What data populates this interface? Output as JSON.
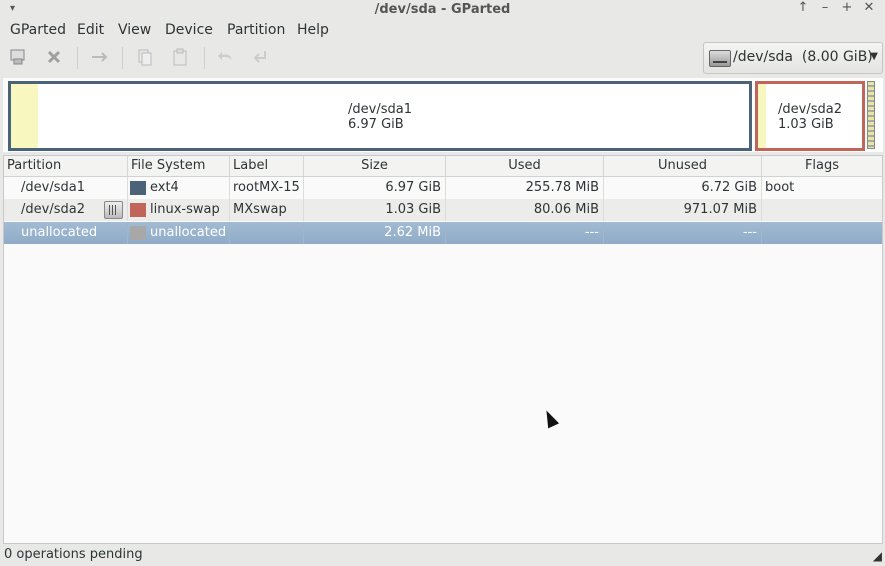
{
  "window": {
    "title": "/dev/sda - GParted",
    "menu_arrow": "▾",
    "controls": [
      "↑",
      "–",
      "+",
      "✕"
    ]
  },
  "menubar": [
    "GParted",
    "Edit",
    "View",
    "Device",
    "Partition",
    "Help"
  ],
  "toolbar": {
    "icons": [
      "new-partition-icon",
      "delete-icon",
      "resize-move-icon",
      "copy-icon",
      "paste-icon",
      "undo-icon",
      "apply-icon"
    ]
  },
  "device_selector": {
    "label": "/dev/sda  (8.00 GiB)"
  },
  "disk_map": {
    "sda1": {
      "name": "/dev/sda1",
      "size": "6.97 GiB",
      "used_fraction": 0.036
    },
    "sda2": {
      "name": "/dev/sda2",
      "size": "1.03 GiB",
      "used_fraction": 0.076
    }
  },
  "table": {
    "headers": [
      "Partition",
      "File System",
      "Label",
      "Size",
      "Used",
      "Unused",
      "Flags"
    ],
    "rows": [
      {
        "partition": "/dev/sda1",
        "fs": "ext4",
        "fs_color": "#4a6378",
        "label": "rootMX-15",
        "size": "6.97 GiB",
        "used": "255.78 MiB",
        "unused": "6.72 GiB",
        "flags": "boot",
        "locked": false
      },
      {
        "partition": "/dev/sda2",
        "fs": "linux-swap",
        "fs_color": "#c1655a",
        "label": "MXswap",
        "size": "1.03 GiB",
        "used": "80.06 MiB",
        "unused": "971.07 MiB",
        "flags": "",
        "locked": true
      },
      {
        "partition": "unallocated",
        "fs": "unallocated",
        "fs_color": "#a8a8a8",
        "label": "",
        "size": "2.62 MiB",
        "used": "---",
        "unused": "---",
        "flags": "",
        "locked": false
      }
    ]
  },
  "status": {
    "text": "0 operations pending"
  }
}
